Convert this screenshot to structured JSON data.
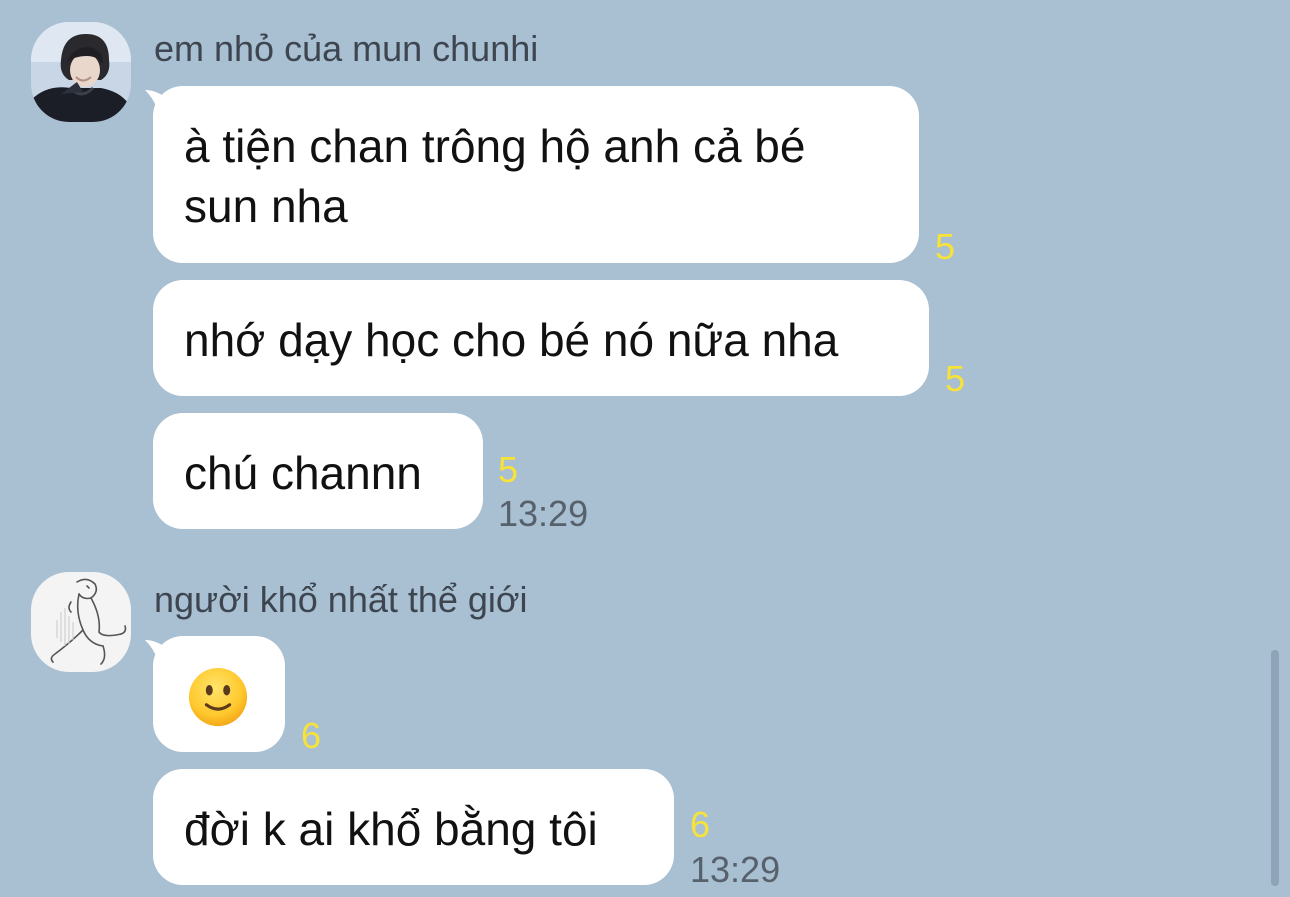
{
  "groups": [
    {
      "sender": "em nhỏ của mun chunhi",
      "avatar_icon": "profile-photo-icon",
      "messages": [
        {
          "text": "à tiện chan trông hộ anh cả bé\nsun nha",
          "read": "5",
          "time": ""
        },
        {
          "text": "nhớ dạy học cho bé nó nữa nha",
          "read": "5",
          "time": ""
        },
        {
          "text": "chú channn",
          "read": "5",
          "time": "13:29"
        }
      ]
    },
    {
      "sender": "người khổ nhất thể giới",
      "avatar_icon": "sketch-drawing-icon",
      "messages": [
        {
          "emoji": "slightly-smiling-face-icon",
          "read": "6",
          "time": ""
        },
        {
          "text": "đời k ai khổ bằng tôi",
          "read": "6",
          "time": "13:29"
        }
      ]
    }
  ],
  "colors": {
    "background": "#a9bfd2",
    "bubble": "#ffffff",
    "read_count": "#f7e23a",
    "timestamp": "#56616c"
  }
}
